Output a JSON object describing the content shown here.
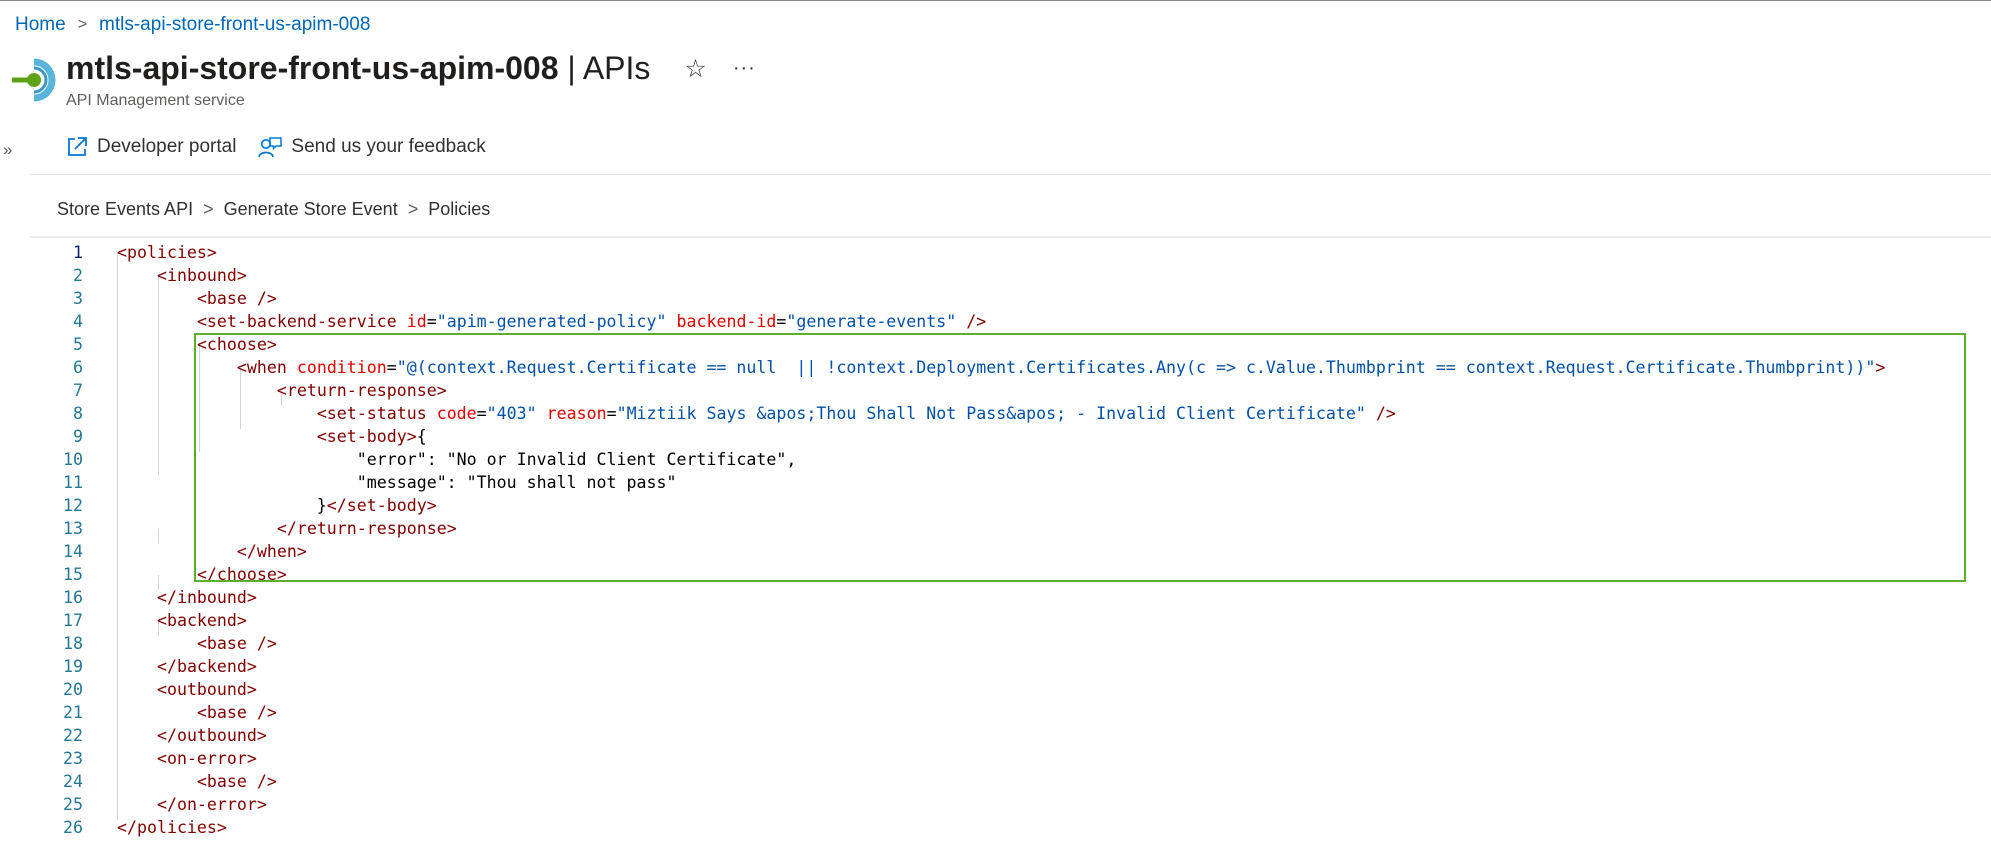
{
  "breadcrumb": {
    "home": "Home",
    "separator": ">",
    "current": "mtls-api-store-front-us-apim-008"
  },
  "header": {
    "title": "mtls-api-store-front-us-apim-008",
    "title_separator": " | ",
    "title_section": "APIs",
    "subtitle": "API Management service",
    "star_icon": "☆",
    "more_icon": "···",
    "expand_icon": "»"
  },
  "toolbar": {
    "developer_portal": "Developer portal",
    "feedback": "Send us your feedback"
  },
  "crumb2": {
    "api": "Store Events API",
    "operation": "Generate Store Event",
    "section": "Policies",
    "separator": ">"
  },
  "colors": {
    "accent": "#0067b8",
    "highlight_border": "#5eae2e",
    "tag": "#800000",
    "attr": "#e50000",
    "string": "#0451a5",
    "line_number": "#237893"
  },
  "editor": {
    "active_line": 1,
    "highlight_lines": [
      5,
      15
    ],
    "lines": [
      [
        [
          "t",
          "<policies>"
        ]
      ],
      [
        [
          "p",
          "    "
        ],
        [
          "t",
          "<inbound>"
        ]
      ],
      [
        [
          "p",
          "        "
        ],
        [
          "t",
          "<base />"
        ]
      ],
      [
        [
          "p",
          "        "
        ],
        [
          "t",
          "<set-backend-service "
        ],
        [
          "a",
          "id"
        ],
        [
          "p",
          "="
        ],
        [
          "v",
          "\"apim-generated-policy\""
        ],
        [
          "p",
          " "
        ],
        [
          "a",
          "backend-id"
        ],
        [
          "p",
          "="
        ],
        [
          "v",
          "\"generate-events\""
        ],
        [
          "t",
          " />"
        ]
      ],
      [
        [
          "p",
          "        "
        ],
        [
          "t",
          "<choose>"
        ]
      ],
      [
        [
          "p",
          "            "
        ],
        [
          "t",
          "<when "
        ],
        [
          "a",
          "condition"
        ],
        [
          "p",
          "="
        ],
        [
          "v",
          "\"@(context.Request.Certificate == null  || !context.Deployment.Certificates.Any(c => c.Value.Thumbprint == context.Request.Certificate.Thumbprint))\""
        ],
        [
          "t",
          ">"
        ]
      ],
      [
        [
          "p",
          "                "
        ],
        [
          "t",
          "<return-response>"
        ]
      ],
      [
        [
          "p",
          "                    "
        ],
        [
          "t",
          "<set-status "
        ],
        [
          "a",
          "code"
        ],
        [
          "p",
          "="
        ],
        [
          "v",
          "\"403\""
        ],
        [
          "p",
          " "
        ],
        [
          "a",
          "reason"
        ],
        [
          "p",
          "="
        ],
        [
          "v",
          "\"Miztiik Says &apos;Thou Shall Not Pass&apos; - Invalid Client Certificate\""
        ],
        [
          "t",
          " />"
        ]
      ],
      [
        [
          "p",
          "                    "
        ],
        [
          "t",
          "<set-body>"
        ],
        [
          "p",
          "{"
        ]
      ],
      [
        [
          "p",
          "                        \"error\": \"No or Invalid Client Certificate\","
        ]
      ],
      [
        [
          "p",
          "                        \"message\": \"Thou shall not pass\""
        ]
      ],
      [
        [
          "p",
          "                    }"
        ],
        [
          "t",
          "</set-body>"
        ]
      ],
      [
        [
          "p",
          "                "
        ],
        [
          "t",
          "</return-response>"
        ]
      ],
      [
        [
          "p",
          "            "
        ],
        [
          "t",
          "</when>"
        ]
      ],
      [
        [
          "p",
          "        "
        ],
        [
          "t",
          "</choose>"
        ]
      ],
      [
        [
          "p",
          "    "
        ],
        [
          "t",
          "</inbound>"
        ]
      ],
      [
        [
          "p",
          "    "
        ],
        [
          "t",
          "<backend>"
        ]
      ],
      [
        [
          "p",
          "        "
        ],
        [
          "t",
          "<base />"
        ]
      ],
      [
        [
          "p",
          "    "
        ],
        [
          "t",
          "</backend>"
        ]
      ],
      [
        [
          "p",
          "    "
        ],
        [
          "t",
          "<outbound>"
        ]
      ],
      [
        [
          "p",
          "        "
        ],
        [
          "t",
          "<base />"
        ]
      ],
      [
        [
          "p",
          "    "
        ],
        [
          "t",
          "</outbound>"
        ]
      ],
      [
        [
          "p",
          "    "
        ],
        [
          "t",
          "<on-error>"
        ]
      ],
      [
        [
          "p",
          "        "
        ],
        [
          "t",
          "<base />"
        ]
      ],
      [
        [
          "p",
          "    "
        ],
        [
          "t",
          "</on-error>"
        ]
      ],
      [
        [
          "t",
          "</policies>"
        ]
      ]
    ]
  }
}
